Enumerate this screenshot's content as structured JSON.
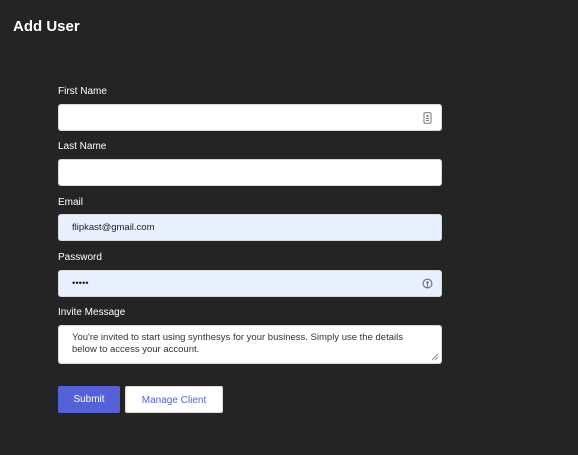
{
  "page": {
    "title": "Add User"
  },
  "form": {
    "first_name": {
      "label": "First Name",
      "value": ""
    },
    "last_name": {
      "label": "Last Name",
      "value": ""
    },
    "email": {
      "label": "Email",
      "value": "flipkast@gmail.com"
    },
    "password": {
      "label": "Password",
      "value": "•••••"
    },
    "invite_message": {
      "label": "Invite Message",
      "value": "You're invited to start using synthesys for your business. Simply use the details below to access your account."
    }
  },
  "actions": {
    "submit_label": "Submit",
    "manage_label": "Manage Client"
  },
  "icons": {
    "first_name": "contact-card-icon",
    "password": "password-manager-key-icon"
  },
  "colors": {
    "background": "#242424",
    "accent": "#5561d7",
    "autofill": "#e8f0fe"
  }
}
